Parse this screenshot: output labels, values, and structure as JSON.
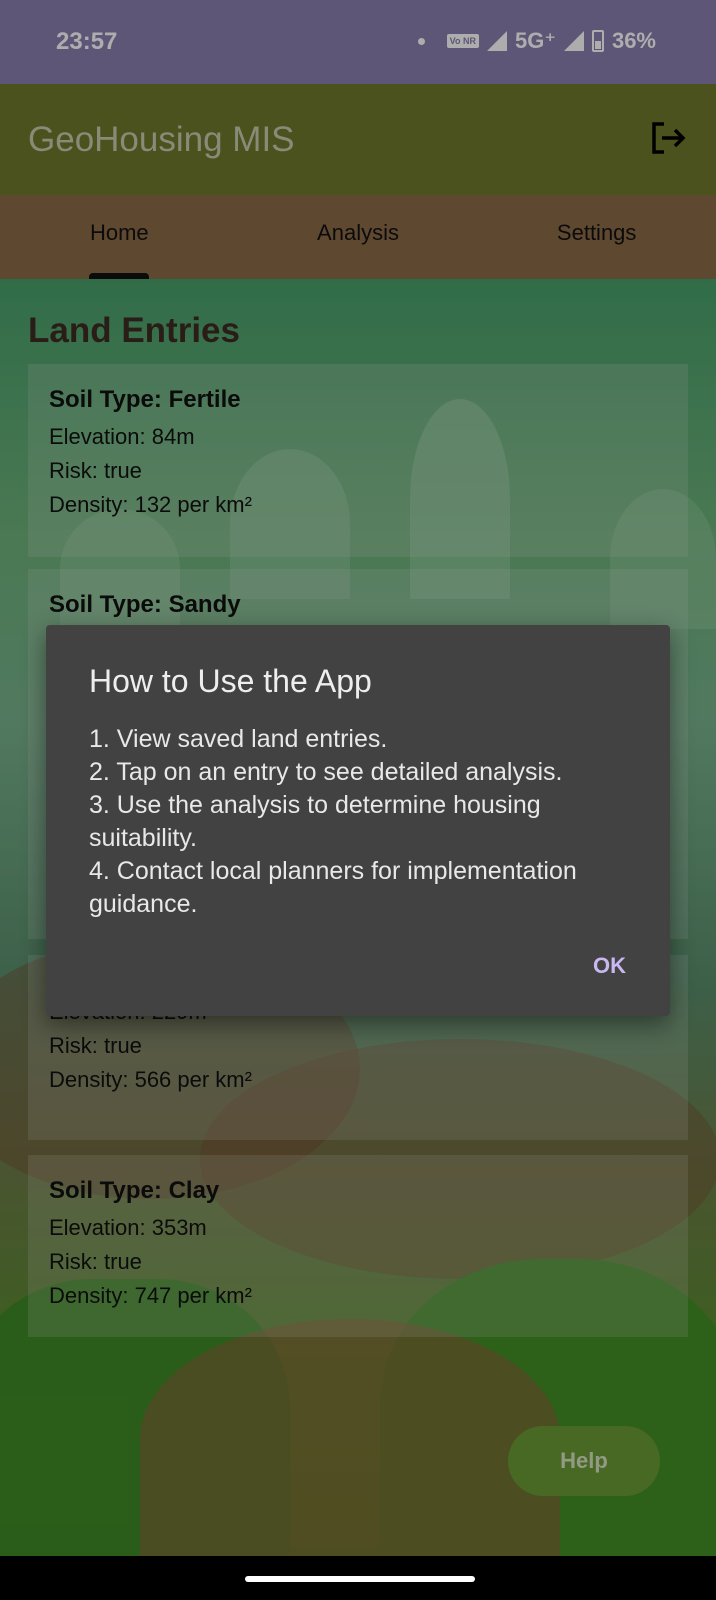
{
  "status_bar": {
    "time": "23:57",
    "network": "5G⁺",
    "volte": "Vo NR",
    "battery": "36%"
  },
  "app_bar": {
    "title": "GeoHousing MIS",
    "logout_icon": "logout-icon"
  },
  "tabs": [
    {
      "label": "Home",
      "selected": true
    },
    {
      "label": "Analysis",
      "selected": false
    },
    {
      "label": "Settings",
      "selected": false
    }
  ],
  "main": {
    "section_title": "Land Entries",
    "entries": [
      {
        "soil": "Soil Type: Fertile",
        "elevation": "Elevation: 84m",
        "risk": "Risk: true",
        "density": "Density: 132 per km²"
      },
      {
        "soil": "Soil Type: Sandy"
      },
      {
        "elevation": "Elevation: 229m",
        "risk": "Risk: true",
        "density": "Density: 566 per km²"
      },
      {
        "soil": "Soil Type: Clay",
        "elevation": "Elevation: 353m",
        "risk": "Risk: true",
        "density": "Density: 747 per km²"
      }
    ],
    "help_button": "Help"
  },
  "dialog": {
    "title": "How to Use the App",
    "body": "1. View saved land entries.\n2. Tap on an entry to see detailed analysis.\n3. Use the analysis to determine housing suitability.\n4. Contact local planners for implementation guidance.",
    "ok_button": "OK"
  },
  "colors": {
    "status_bar": "#8b7fae",
    "app_bar": "#6f7a2b",
    "tab_bar": "#8d6b48",
    "dialog_bg": "#424242",
    "accent": "#c9b7f0"
  }
}
